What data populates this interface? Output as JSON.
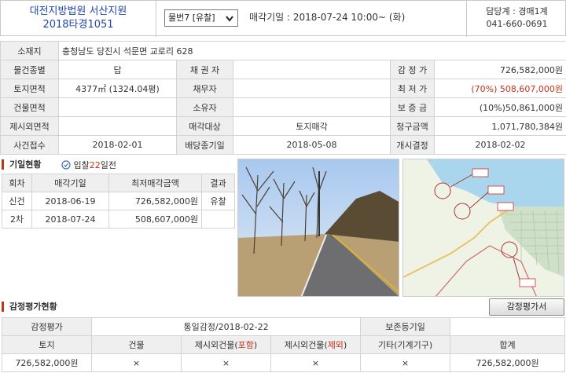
{
  "header": {
    "court_name": "대전지방법원 서산지원",
    "case_number": "2018타경1051",
    "item_select": "물번7 [유찰]",
    "auction_date_label": "매각기일 :",
    "auction_date_value": "2018-07-24 10:00~ (화)",
    "contact_line1": "담당계 : 경매1계",
    "contact_line2": "041-660-0691"
  },
  "info": {
    "location_label": "소재지",
    "location_value": "충청남도 당진시 석문면 교로리 628",
    "type_label": "물건종별",
    "type_value": "답",
    "creditor_label": "채 권 자",
    "creditor_value": "",
    "appraisal_label": "감 정 가",
    "appraisal_value": "726,582,000원",
    "land_area_label": "토지면적",
    "land_area_value": "4377㎡ (1324.04평)",
    "debtor_label": "채무자",
    "debtor_value": "",
    "min_price_label": "최 저 가",
    "min_price_value": "(70%) 508,607,000원",
    "bldg_area_label": "건물면적",
    "bldg_area_value": "",
    "owner_label": "소유자",
    "owner_value": "",
    "deposit_label": "보 증 금",
    "deposit_value": "(10%)50,861,000원",
    "excluded_label": "제시외면적",
    "excluded_value": "",
    "target_label": "매각대상",
    "target_value": "토지매각",
    "claim_label": "청구금액",
    "claim_value": "1,071,780,384원",
    "received_label": "사건접수",
    "received_value": "2018-02-01",
    "dividend_label": "배당종기일",
    "dividend_value": "2018-05-08",
    "decision_label": "개시결정",
    "decision_value": "2018-02-02"
  },
  "history": {
    "section_title": "기일현황",
    "view_prefix": "입찰",
    "view_num": "22",
    "view_suffix": "일전",
    "headers": [
      "회차",
      "매각기일",
      "최저매각금액",
      "결과"
    ],
    "rows": [
      {
        "round": "신건",
        "date": "2018-06-19",
        "price": "726,582,000원",
        "result": "유찰"
      },
      {
        "round": "2차",
        "date": "2018-07-24",
        "price": "508,607,000원",
        "result": ""
      }
    ]
  },
  "appraisal": {
    "section_title": "감정평가현황",
    "button_label": "감정평가서",
    "row1_label": "감정평가",
    "row1_value": "통일감정/2018-02-22",
    "row1_label2": "보존등기일",
    "row1_value2": "",
    "headers": {
      "land": "토지",
      "building": "건물",
      "incl_prefix": "제시외건물(",
      "incl_word": "포함",
      "excl_word": "제외",
      "paren_close": ")",
      "machine": "기타(기계기구)",
      "total": "합계"
    },
    "values": {
      "land": "726,582,000원",
      "building": "×",
      "incl": "×",
      "excl": "×",
      "machine": "×",
      "total": "726,582,000원"
    }
  },
  "colors": {
    "court_blue": "#1f46a8",
    "accent_red": "#c4311b",
    "label_bg": "#efefef"
  }
}
